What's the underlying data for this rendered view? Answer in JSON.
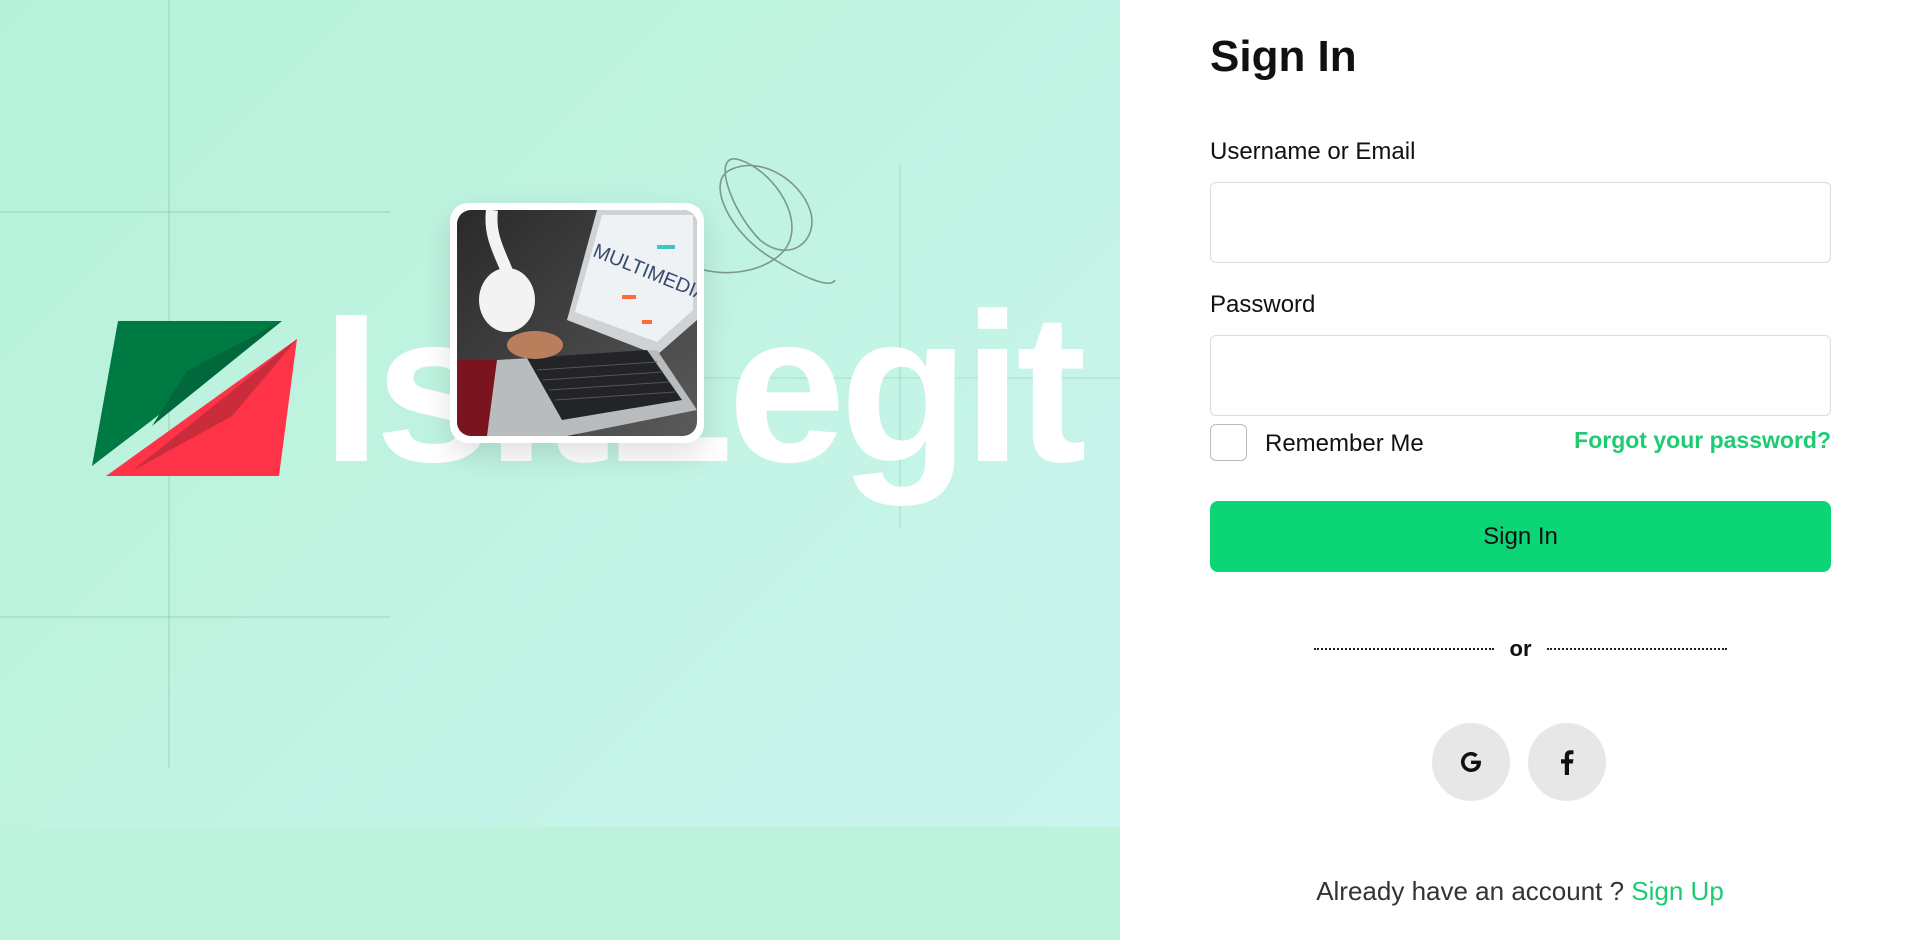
{
  "brand": {
    "wordmark": "IsItLegit",
    "colors": {
      "green_dark": "#007a43",
      "red": "#ff3347",
      "background": "#bff3e0"
    }
  },
  "hero_image": {
    "screen_text": "MULTIMEDIA"
  },
  "form": {
    "title": "Sign In",
    "username_label": "Username or Email",
    "username_value": "",
    "password_label": "Password",
    "password_value": "",
    "remember_label": "Remember Me",
    "remember_checked": false,
    "forgot_label": "Forgot your password?",
    "submit_label": "Sign In",
    "divider_text": "or"
  },
  "social": [
    {
      "name": "google",
      "icon": "google-icon"
    },
    {
      "name": "facebook",
      "icon": "facebook-icon"
    }
  ],
  "footer": {
    "prompt": "Already have an account ?",
    "signup_label": "Sign Up"
  },
  "accent_color": "#0bd575"
}
